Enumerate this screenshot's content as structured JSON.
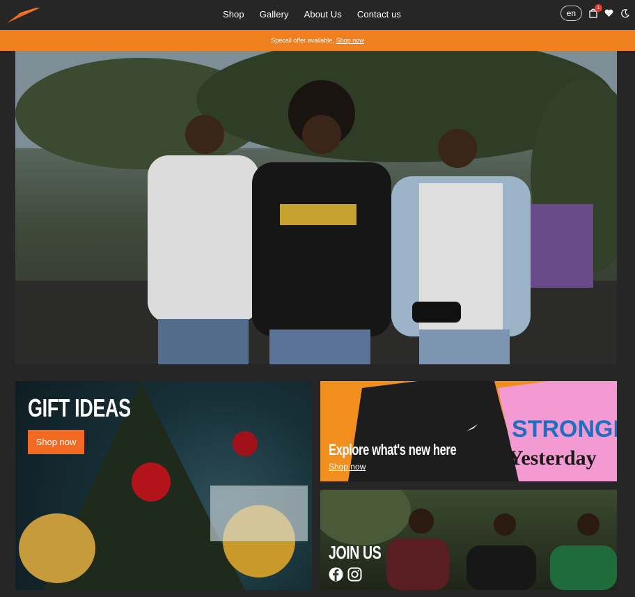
{
  "nav": {
    "items": [
      "Shop",
      "Gallery",
      "About Us",
      "Contact us"
    ],
    "language": "en",
    "cart_count": "1"
  },
  "promo": {
    "text": "Specail offer available,",
    "link": "Shop now"
  },
  "cards": {
    "gift": {
      "title": "GIFT IDEAS",
      "button": "Shop now"
    },
    "explore": {
      "title": "Explore what's new here",
      "link": "Shop now"
    },
    "join": {
      "title": "JOIN US"
    }
  },
  "colors": {
    "accent": "#f07f1e",
    "button": "#f26a21",
    "background": "#262626"
  }
}
